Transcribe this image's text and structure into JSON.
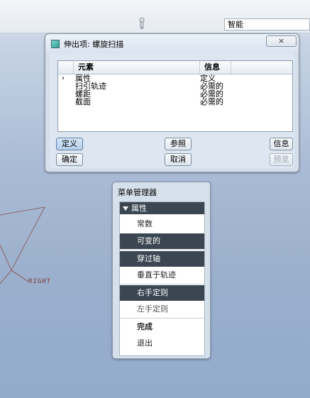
{
  "toolbar": {
    "filter_value": "智能"
  },
  "viewport": {
    "datum_label": "RIGHT"
  },
  "dialog": {
    "title": "伸出项: 螺旋扫描",
    "close_label": "×",
    "table": {
      "columns": [
        "元素",
        "信息"
      ],
      "rows": [
        {
          "marker": "›",
          "element": "属性",
          "info": "定义"
        },
        {
          "marker": "",
          "element": "扫引轨迹",
          "info": "必需的"
        },
        {
          "marker": "",
          "element": "螺距",
          "info": "必需的"
        },
        {
          "marker": "",
          "element": "截面",
          "info": "必需的"
        }
      ]
    },
    "buttons": {
      "define": "定义",
      "refs": "参照",
      "info": "信息",
      "ok": "确定",
      "cancel": "取消",
      "preview": "预览"
    }
  },
  "menu_manager": {
    "title": "菜单管理器",
    "section": "属性",
    "items": [
      {
        "label": "常数"
      },
      {
        "label": "可变的"
      },
      {
        "label": "穿过轴"
      },
      {
        "label": "垂直于轨迹"
      },
      {
        "label": "右手定则"
      },
      {
        "label": "左手定则"
      },
      {
        "label": "完成"
      },
      {
        "label": "退出"
      }
    ]
  }
}
